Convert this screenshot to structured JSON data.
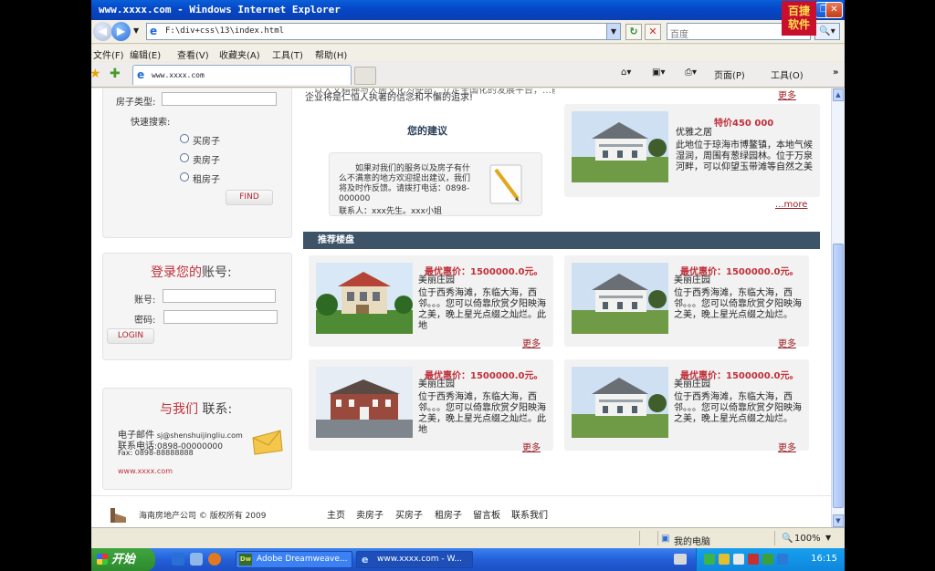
{
  "window": {
    "title": "www.xxxx.com - Windows Internet Explorer",
    "badge_line1": "百捷",
    "badge_line2": "软件"
  },
  "address_bar": {
    "url": "F:\\div+css\\13\\index.html",
    "search_placeholder": "百度"
  },
  "menu": [
    "文件(F)",
    "编辑(E)",
    "查看(V)",
    "收藏夹(A)",
    "工具(T)",
    "帮助(H)"
  ],
  "tab": {
    "label": "www.xxxx.com"
  },
  "toolbar_right": {
    "page": "页面(P)",
    "tools": "工具(O)"
  },
  "left": {
    "house_type_label": "房子类型:",
    "quick_search_label": "快速搜索:",
    "radio_options": [
      "买房子",
      "卖房子",
      "租房子"
    ],
    "find_button": "FIND",
    "login_title_red": "登录您的",
    "login_title_gray": "账号:",
    "account_label": "账号:",
    "password_label": "密码:",
    "login_button": "LOGIN",
    "contact_title_red": "与我们",
    "contact_title_gray": "联系:",
    "email_label": "电子邮件",
    "email_value": "sj@shenshuijingliu.com",
    "phone_label": "联系电话",
    "phone_value": ":0898-00000000",
    "fax": "Fax: 0898-88888888",
    "site": "www.xxxx.com"
  },
  "middle": {
    "top_text": "企业将是仁恒人执著的信念和不懈的追求!",
    "top_partial": "…以人文精神与人居文化为使命，立足全国化的发展平台，…前",
    "suggest_title": "您的建议",
    "suggest_text": "如果对我们的服务以及房子有什么不满意的地方欢迎提出建议，我们将及时作反馈。请拨打电话：0898-000000",
    "suggest_contact": "联系人：xxx先生。xxx小姐"
  },
  "right_top": {
    "more_top": "更多",
    "price": "特价450 000",
    "name": "优雅之居",
    "desc": "此地位于琼海市博鳌镇，本地气候湿润，周围有葱绿园林。位于万泉河畔，可以仰望玉带滩等自然之美",
    "more": "...more"
  },
  "section_title": "推荐楼盘",
  "listings": [
    {
      "price": "最优惠价：1500000.0元。",
      "name": "美丽庄园",
      "desc": "位于西秀海滩，东临大海，西邻。。。您可以倚靠欣赏夕阳映海之美，晚上星光点缀之灿烂。此地",
      "more": "更多"
    },
    {
      "price": "最优惠价：1500000.0元。",
      "name": "美丽庄园",
      "desc": "位于西秀海滩，东临大海，西邻。。。您可以倚靠欣赏夕阳映海之美，晚上星光点缀之灿烂。",
      "more": "更多"
    },
    {
      "price": "最优惠价：1500000.0元。",
      "name": "美丽庄园",
      "desc": "位于西秀海滩，东临大海，西邻。。。您可以倚靠欣赏夕阳映海之美，晚上星光点缀之灿烂。此地",
      "more": "更多"
    },
    {
      "price": "最优惠价：1500000.0元。",
      "name": "美丽庄园",
      "desc": "位于西秀海滩，东临大海，西邻。。。您可以倚靠欣赏夕阳映海之美，晚上星光点缀之灿烂。",
      "more": "更多"
    }
  ],
  "footer": {
    "copyright": "海南房地产公司 © 版权所有  2009",
    "nav": [
      "主页",
      "卖房子",
      "买房子",
      "租房子",
      "留言板",
      "联系我们"
    ]
  },
  "status_bar": {
    "zone": "我的电脑",
    "zoom": "100%"
  },
  "taskbar": {
    "start": "开始",
    "items": [
      "Adobe Dreamweave...",
      "www.xxxx.com - W..."
    ],
    "clock": "16:15"
  }
}
